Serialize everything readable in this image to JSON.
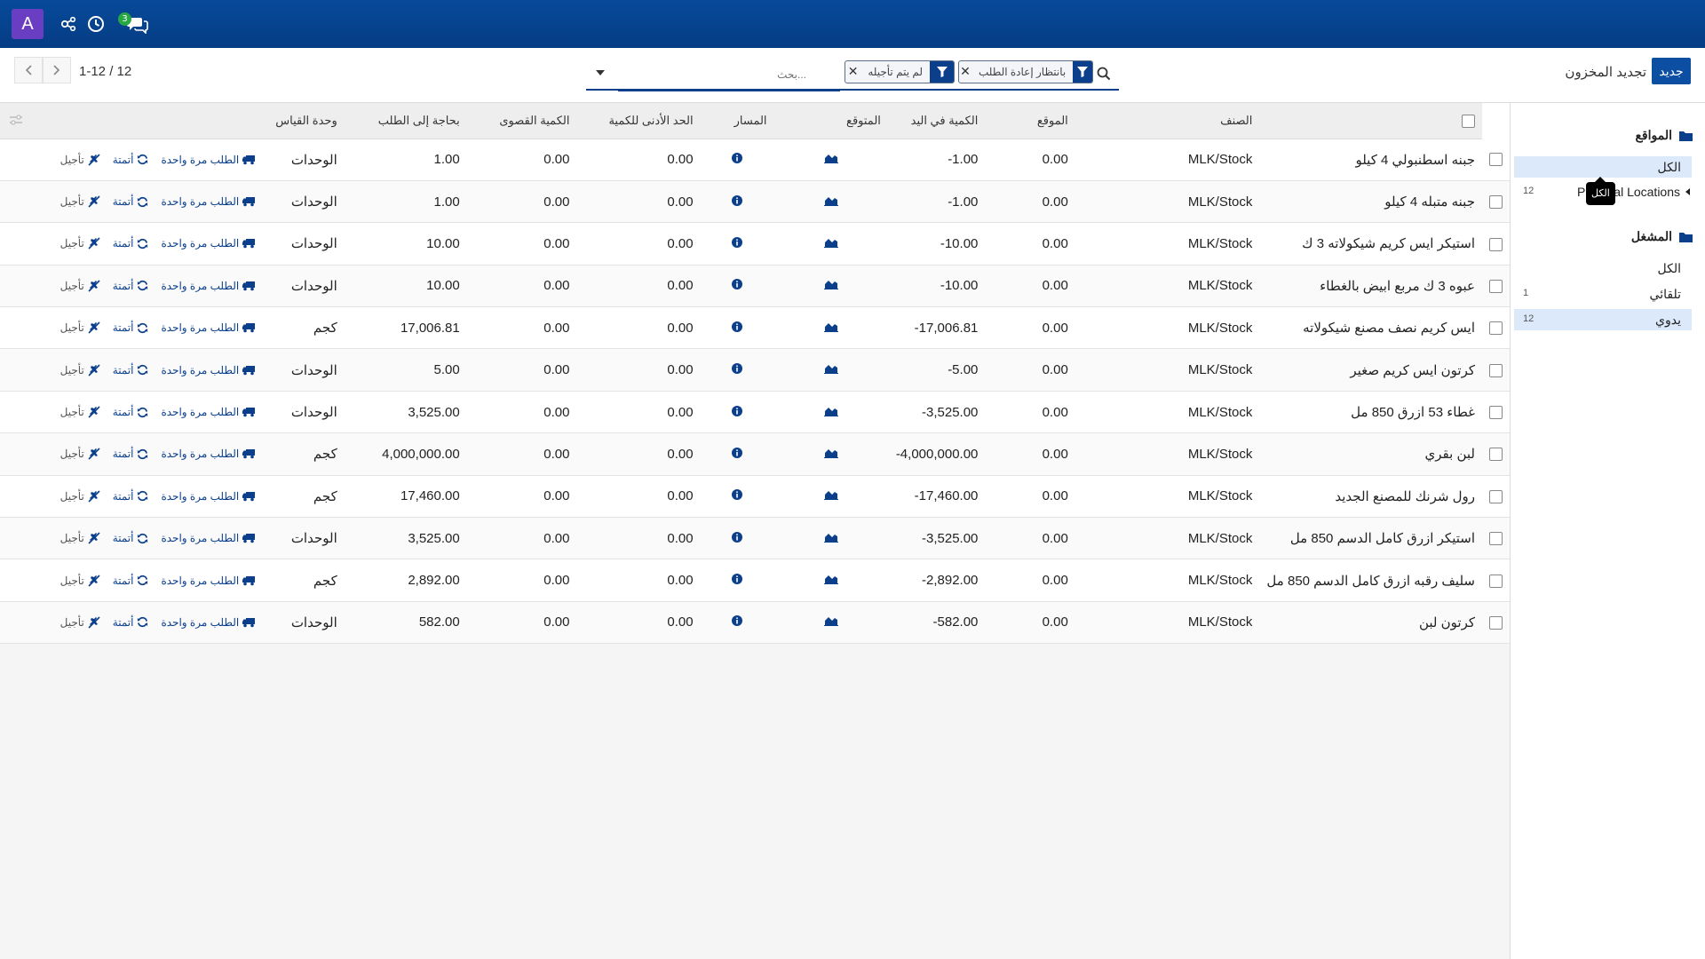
{
  "navbar": {
    "avatar_letter": "A",
    "chat_badge": "3"
  },
  "control": {
    "new_button": "جديد",
    "breadcrumb": "تجديد المخزون",
    "search_placeholder": "بحث...",
    "facets": [
      {
        "label": "بانتظار إعادة الطلب"
      },
      {
        "label": "لم يتم تأجيله"
      }
    ],
    "pager_value": "1-12 / 12"
  },
  "table": {
    "headers": {
      "product": "الصنف",
      "location": "الموقع",
      "on_hand": "الكمية في اليد",
      "forecast": "المتوقع",
      "route": "المسار",
      "min_qty": "الحد الأدنى للكمية",
      "max_qty": "الكمية القصوى",
      "to_order": "بحاجة إلى الطلب",
      "uom": "وحدة القياس"
    },
    "actions": {
      "order_once": "الطلب مرة واحدة",
      "automate": "أتمتة",
      "snooze": "تأجيل"
    },
    "rows": [
      {
        "product": "جبنه اسطنبولي 4 كيلو",
        "location": "MLK/Stock",
        "on_hand": "0.00",
        "forecast": "-1.00",
        "min_qty": "0.00",
        "max_qty": "0.00",
        "to_order": "1.00",
        "uom": "الوحدات"
      },
      {
        "product": "جبنه متبله 4 كيلو",
        "location": "MLK/Stock",
        "on_hand": "0.00",
        "forecast": "-1.00",
        "min_qty": "0.00",
        "max_qty": "0.00",
        "to_order": "1.00",
        "uom": "الوحدات"
      },
      {
        "product": "استيكر ايس كريم شيكولاته 3 ك",
        "location": "MLK/Stock",
        "on_hand": "0.00",
        "forecast": "-10.00",
        "min_qty": "0.00",
        "max_qty": "0.00",
        "to_order": "10.00",
        "uom": "الوحدات"
      },
      {
        "product": "عبوه 3 ك مربع ابيض بالغطاء",
        "location": "MLK/Stock",
        "on_hand": "0.00",
        "forecast": "-10.00",
        "min_qty": "0.00",
        "max_qty": "0.00",
        "to_order": "10.00",
        "uom": "الوحدات"
      },
      {
        "product": "ايس كريم نصف مصنع شيكولاته",
        "location": "MLK/Stock",
        "on_hand": "0.00",
        "forecast": "-17,006.81",
        "min_qty": "0.00",
        "max_qty": "0.00",
        "to_order": "17,006.81",
        "uom": "كجم"
      },
      {
        "product": "كرتون ايس كريم صغير",
        "location": "MLK/Stock",
        "on_hand": "0.00",
        "forecast": "-5.00",
        "min_qty": "0.00",
        "max_qty": "0.00",
        "to_order": "5.00",
        "uom": "الوحدات"
      },
      {
        "product": "غطاء 53 ازرق 850 مل",
        "location": "MLK/Stock",
        "on_hand": "0.00",
        "forecast": "-3,525.00",
        "min_qty": "0.00",
        "max_qty": "0.00",
        "to_order": "3,525.00",
        "uom": "الوحدات"
      },
      {
        "product": "لبن بقري",
        "location": "MLK/Stock",
        "on_hand": "0.00",
        "forecast": "-4,000,000.00",
        "min_qty": "0.00",
        "max_qty": "0.00",
        "to_order": "4,000,000.00",
        "uom": "كجم"
      },
      {
        "product": "رول شرنك للمصنع الجديد",
        "location": "MLK/Stock",
        "on_hand": "0.00",
        "forecast": "-17,460.00",
        "min_qty": "0.00",
        "max_qty": "0.00",
        "to_order": "17,460.00",
        "uom": "كجم"
      },
      {
        "product": "استيكر ازرق كامل الدسم 850 مل",
        "location": "MLK/Stock",
        "on_hand": "0.00",
        "forecast": "-3,525.00",
        "min_qty": "0.00",
        "max_qty": "0.00",
        "to_order": "3,525.00",
        "uom": "الوحدات"
      },
      {
        "product": "سليف رقبه ازرق كامل الدسم 850 مل",
        "location": "MLK/Stock",
        "on_hand": "0.00",
        "forecast": "-2,892.00",
        "min_qty": "0.00",
        "max_qty": "0.00",
        "to_order": "2,892.00",
        "uom": "كجم"
      },
      {
        "product": "كرتون لبن",
        "location": "MLK/Stock",
        "on_hand": "0.00",
        "forecast": "-582.00",
        "min_qty": "0.00",
        "max_qty": "0.00",
        "to_order": "582.00",
        "uom": "الوحدات"
      }
    ]
  },
  "panel": {
    "locations": {
      "title": "المواقع",
      "all": "الكل",
      "items": [
        {
          "label": "Physical Locations",
          "count": "12"
        }
      ]
    },
    "trigger": {
      "title": "المشغل",
      "all": "الكل",
      "items": [
        {
          "label": "تلقائي",
          "count": "1"
        },
        {
          "label": "يدوي",
          "count": "12"
        }
      ]
    },
    "tooltip": "الكل"
  },
  "colors": {
    "navbar": "#074a9a",
    "primary": "#0b4ea2",
    "avatar": "#6a3ec2",
    "badge": "#28a745",
    "active_filter": "#dbe9fb"
  },
  "icons": {
    "nav": [
      "settings-share-icon",
      "clock-icon",
      "chat-icon"
    ],
    "row": [
      "chart-icon",
      "info-icon",
      "truck-icon",
      "refresh-icon",
      "snooze-icon"
    ]
  }
}
